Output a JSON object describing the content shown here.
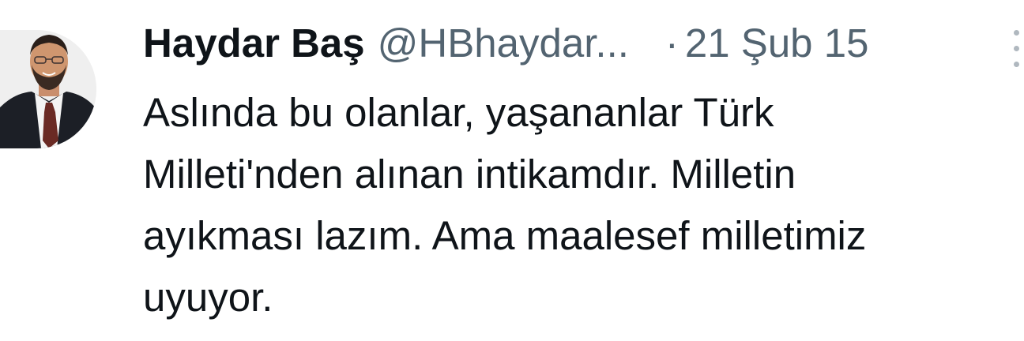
{
  "tweet": {
    "display_name": "Haydar Baş",
    "handle": "@HBhaydar...",
    "separator": "·",
    "date": "21 Şub 15",
    "text_lines": [
      "Aslında bu olanlar, yaşananlar Türk",
      "Milleti'nden alınan intikamdır. Milletin",
      "ayıkması lazım. Ama maalesef milletimiz",
      "uyuyor."
    ],
    "avatar_icon": "profile-photo",
    "more_icon": "more-options-icon"
  },
  "colors": {
    "text_primary": "#0f1419",
    "text_secondary": "#536471",
    "background": "#ffffff"
  }
}
